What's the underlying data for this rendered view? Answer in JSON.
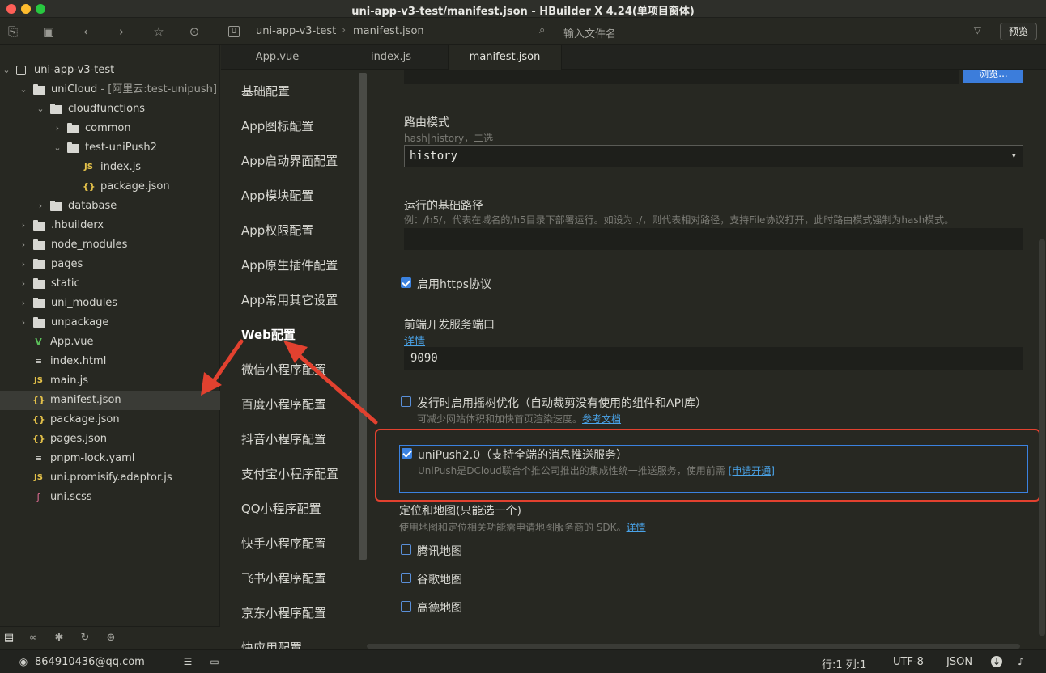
{
  "window": {
    "title": "uni-app-v3-test/manifest.json - HBuilder X 4.24(单项目窗体)"
  },
  "toolbar": {
    "breadcrumb": [
      "uni-app-v3-test",
      "manifest.json"
    ],
    "breadcrumb_badge": "U",
    "file_search_placeholder": "输入文件名",
    "preview_label": "预览"
  },
  "tree": {
    "items": [
      {
        "label": "uni-app-v3-test",
        "icon": "project-icon",
        "chevron": "down"
      },
      {
        "label": "uniCloud",
        "suffix": " - [阿里云:test-unipush]",
        "icon": "folder-open-icon",
        "chevron": "down"
      },
      {
        "label": "cloudfunctions",
        "icon": "folder-open-icon",
        "chevron": "down"
      },
      {
        "label": "common",
        "icon": "folder-icon",
        "chevron": "right"
      },
      {
        "label": "test-uniPush2",
        "icon": "folder-open-icon",
        "chevron": "down"
      },
      {
        "label": "index.js",
        "icon": "js-icon",
        "glyph": "JS"
      },
      {
        "label": "package.json",
        "icon": "json-icon",
        "glyph": "{}"
      },
      {
        "label": "database",
        "icon": "folder-icon",
        "chevron": "right"
      },
      {
        "label": ".hbuilderx",
        "icon": "folder-icon",
        "chevron": "right"
      },
      {
        "label": "node_modules",
        "icon": "folder-icon",
        "chevron": "right"
      },
      {
        "label": "pages",
        "icon": "folder-icon",
        "chevron": "right"
      },
      {
        "label": "static",
        "icon": "folder-icon",
        "chevron": "right"
      },
      {
        "label": "uni_modules",
        "icon": "folder-icon",
        "chevron": "right"
      },
      {
        "label": "unpackage",
        "icon": "folder-icon",
        "chevron": "right"
      },
      {
        "label": "App.vue",
        "icon": "vue-icon",
        "glyph": "V"
      },
      {
        "label": "index.html",
        "icon": "document-icon",
        "glyph": "≡"
      },
      {
        "label": "main.js",
        "icon": "js-icon",
        "glyph": "JS"
      },
      {
        "label": "manifest.json",
        "icon": "json-icon",
        "glyph": "{}",
        "selected": true
      },
      {
        "label": "package.json",
        "icon": "json-icon",
        "glyph": "{}"
      },
      {
        "label": "pages.json",
        "icon": "json-icon",
        "glyph": "{}"
      },
      {
        "label": "pnpm-lock.yaml",
        "icon": "document-icon",
        "glyph": "≡"
      },
      {
        "label": "uni.promisify.adaptor.js",
        "icon": "js-icon",
        "glyph": "JS"
      },
      {
        "label": "uni.scss",
        "icon": "scss-icon",
        "glyph": "ʃ"
      }
    ]
  },
  "tabs": [
    {
      "label": "App.vue"
    },
    {
      "label": "index.js"
    },
    {
      "label": "manifest.json",
      "active": true
    }
  ],
  "config_nav": {
    "items": [
      "基础配置",
      "App图标配置",
      "App启动界面配置",
      "App模块配置",
      "App权限配置",
      "App原生插件配置",
      "App常用其它设置",
      "Web配置",
      "微信小程序配置",
      "百度小程序配置",
      "抖音小程序配置",
      "支付宝小程序配置",
      "QQ小程序配置",
      "快手小程序配置",
      "飞书小程序配置",
      "京东小程序配置",
      "快应用配置"
    ],
    "active_index": 7
  },
  "content": {
    "browse_label": "浏览...",
    "router_mode": {
      "label": "路由模式",
      "hint": "hash|history，二选一",
      "value": "history"
    },
    "base_path": {
      "label": "运行的基础路径",
      "hint": "例：/h5/，代表在域名的/h5目录下部署运行。如设为 ./，则代表相对路径，支持File协议打开，此时路由模式强制为hash模式。",
      "value": ""
    },
    "https": {
      "label": "启用https协议",
      "checked": true
    },
    "dev_port": {
      "label": "前端开发服务端口",
      "link": "详情",
      "value": "9090"
    },
    "tree_shaking": {
      "label": "发行时启用摇树优化（自动裁剪没有使用的组件和API库）",
      "hint": "可减少网站体积和加快首页渲染速度。",
      "link": "参考文档",
      "checked": false
    },
    "unipush": {
      "label": "uniPush2.0（支持全端的消息推送服务）",
      "hint": "UniPush是DCloud联合个推公司推出的集成性统一推送服务，使用前需",
      "link": "[申请开通]",
      "checked": true
    },
    "maps": {
      "label": "定位和地图(只能选一个)",
      "hint": "使用地图和定位相关功能需申请地图服务商的 SDK。",
      "link": "详情",
      "options": [
        {
          "label": "腾讯地图",
          "checked": false
        },
        {
          "label": "谷歌地图",
          "checked": false
        },
        {
          "label": "高德地图",
          "checked": false
        }
      ]
    }
  },
  "statusbar": {
    "account": "864910436@qq.com",
    "position": "行:1  列:1",
    "encoding": "UTF-8",
    "language": "JSON"
  },
  "colors": {
    "accent": "#3b82e0",
    "annotation_red": "#e2412f",
    "background": "#272822"
  }
}
